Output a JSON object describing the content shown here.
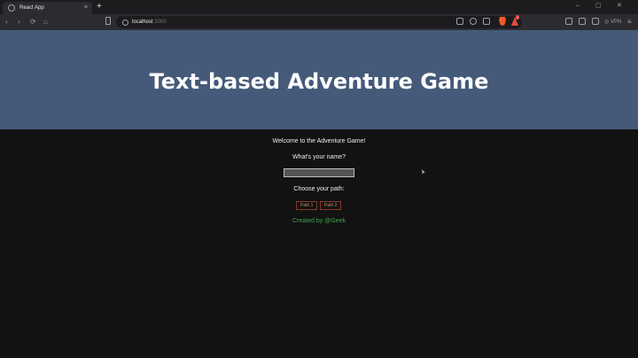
{
  "browser": {
    "tab_title": "React App",
    "tab_close": "×",
    "new_tab": "+",
    "window_controls": [
      "–",
      "▢",
      "✕"
    ],
    "url_host": "localhost",
    "url_port": ":3000",
    "vpn_label": "VPN",
    "menu_glyph": "≡",
    "notification_count": "1"
  },
  "header": {
    "title": "Text-based Adventure Game"
  },
  "game": {
    "welcome_text": "Welcome to the Adventure Game!",
    "name_prompt": "What's your name?",
    "name_value": "",
    "path_prompt": "Choose your path:",
    "path_buttons": [
      "Path 1",
      "Path 2"
    ],
    "credit": "Created by @Geek"
  },
  "colors": {
    "header_bg": "#455a78",
    "page_bg": "#121212",
    "credit_green": "#3aa64a",
    "button_border": "#8a3a2a"
  }
}
